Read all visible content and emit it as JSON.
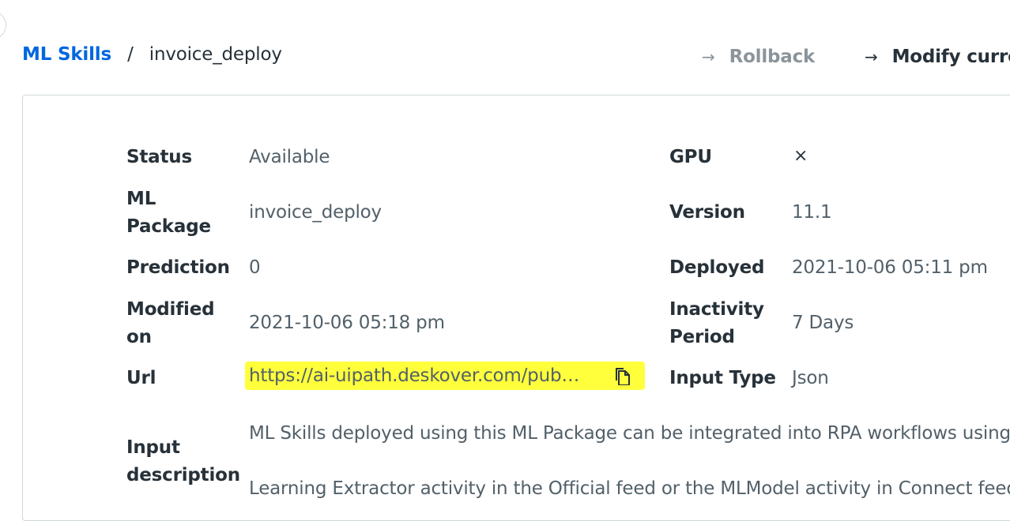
{
  "header": {
    "breadcrumb": {
      "root": "ML Skills",
      "separator": "/",
      "current": "invoice_deploy"
    },
    "actions": {
      "rollback": "Rollback",
      "modify": "Modify curre",
      "arrow": "→"
    }
  },
  "details": {
    "status": {
      "label": "Status",
      "value": "Available"
    },
    "gpu": {
      "label": "GPU",
      "value": "×"
    },
    "ml_package": {
      "label_line1": "ML",
      "label_line2": "Package",
      "value": "invoice_deploy"
    },
    "version": {
      "label": "Version",
      "value": "11.1"
    },
    "prediction": {
      "label": "Prediction",
      "value": "0"
    },
    "deployed": {
      "label": "Deployed",
      "value": "2021-10-06 05:11 pm"
    },
    "modified_on": {
      "label_line1": "Modified",
      "label_line2": "on",
      "value": "2021-10-06 05:18 pm"
    },
    "inactivity_period": {
      "label_line1": "Inactivity",
      "label_line2": "Period",
      "value": "7 Days"
    },
    "url": {
      "label": "Url",
      "value": "https://ai-uipath.deskover.com/publi..."
    },
    "input_type": {
      "label": "Input Type",
      "value": "Json"
    },
    "input_description": {
      "label_line1": "Input",
      "label_line2": "description",
      "line1": "ML Skills deployed using this ML Package can be integrated into RPA workflows using th",
      "line2": "Learning Extractor activity in the Official feed or the MLModel activity in Connect feed. F"
    }
  },
  "colors": {
    "link": "#0067df",
    "text": "#273139",
    "muted": "#526069",
    "highlight": "#ffff3b",
    "disabled": "#8b949a"
  }
}
